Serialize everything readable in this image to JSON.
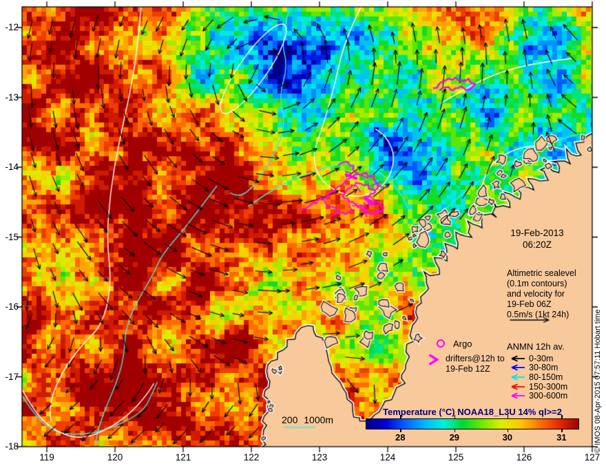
{
  "map": {
    "datetime": {
      "date": "19-Feb-2013",
      "time": "06:20Z"
    },
    "x_axis": {
      "tick_labels": [
        "119",
        "120",
        "121",
        "122",
        "123",
        "124",
        "125",
        "126",
        "127"
      ]
    },
    "y_axis": {
      "tick_labels": [
        "-12",
        "-13",
        "-14",
        "-15",
        "-16",
        "-17",
        "-18"
      ]
    },
    "colors": {
      "land": "#F8C99B",
      "sealevel_contour": "#FFFFFF",
      "isobath_contour": "#40E8E0",
      "velocity_arrow": "#000000",
      "drifter_track": "#FF00FF",
      "frame": "#000000"
    }
  },
  "annotations": {
    "altimetric_note_lines": [
      "Altimetric sealevel",
      "(0.1m contours)",
      "and velocity for",
      "19-Feb 06Z",
      "0.5m/s (1kt 24h)"
    ],
    "scalebar_label": "200 1000m",
    "watermark": "© IMOS 08-Apr-2015 07:57:11 Hobart time"
  },
  "legend": {
    "argo": {
      "label": "Argo",
      "marker": "circle-outline-icon",
      "color": "#FF00FF"
    },
    "drifters": {
      "label_lines": [
        "drifters@12h to",
        "19-Feb 12Z"
      ],
      "marker": "chevron-right-icon",
      "color": "#FF00FF"
    },
    "anmn": {
      "title": "ANMN 12h av.",
      "entries": [
        {
          "label": "0-30m",
          "color": "#000000"
        },
        {
          "label": "30-80m",
          "color": "#0000FF"
        },
        {
          "label": "80-150m",
          "color": "#00E5EE"
        },
        {
          "label": "150-300m",
          "color": "#FF0000"
        },
        {
          "label": "300-600m",
          "color": "#FF00FF"
        }
      ]
    }
  },
  "colorbar": {
    "title": "Temperature (°C) NOAA18_L3U 14% ql>=2",
    "title_color": "#000080",
    "tick_labels": [
      "28",
      "29",
      "30",
      "31"
    ],
    "tick_fractions": [
      0.16,
      0.415,
      0.665,
      0.92
    ],
    "gradient_stops": [
      "#000080",
      "#0000D8",
      "#0060FF",
      "#00B4FF",
      "#00F0E0",
      "#00D830",
      "#70E800",
      "#D8F000",
      "#FFC800",
      "#FF7000",
      "#E82800",
      "#A00000"
    ]
  },
  "chart_data": {
    "type": "heatmap",
    "title": "Temperature (°C) NOAA18_L3U 14% ql>=2",
    "datetime": "19-Feb-2013 06:20Z",
    "x_axis": {
      "range": [
        118.64,
        127.0
      ],
      "ticks": [
        119,
        120,
        121,
        122,
        123,
        124,
        125,
        126,
        127
      ]
    },
    "y_axis": {
      "range": [
        -18.0,
        -11.7
      ],
      "ticks": [
        -12,
        -13,
        -14,
        -15,
        -16,
        -17,
        -18
      ]
    },
    "colorbar": {
      "ticks": [
        28,
        29,
        30,
        31
      ],
      "approx_range": [
        27.4,
        31.3
      ]
    },
    "overlays": [
      "Altimetric sealevel (0.1m contours) and velocity for 19-Feb 06Z, 0.5m/s (1kt 24h)",
      "drifters@12h to 19-Feb 12Z",
      "Argo",
      "ANMN 12h av. currents: 0-30m, 30-80m, 80-150m, 150-300m, 300-600m",
      "200 1000m isobaths"
    ]
  }
}
